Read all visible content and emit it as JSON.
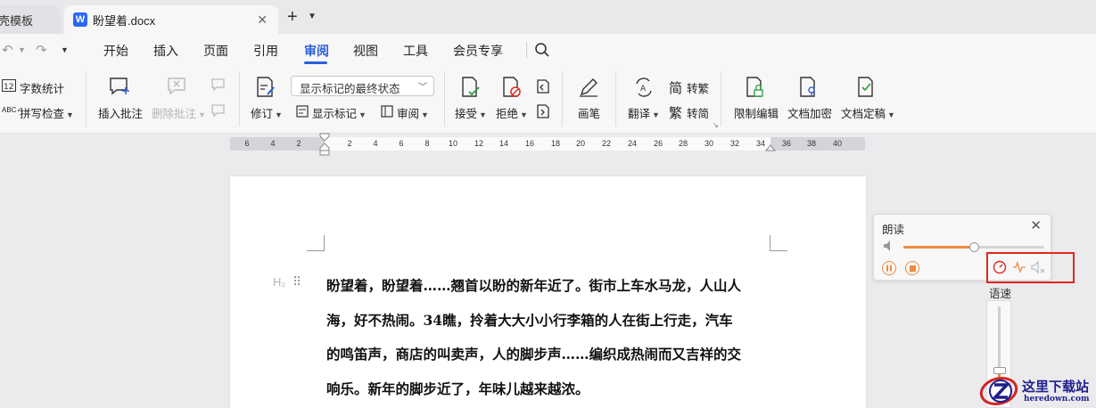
{
  "tabs": {
    "prev_label": "壳模板",
    "active_label": "盼望着.docx",
    "app_letter": "W",
    "close": "✕",
    "add": "+"
  },
  "menu": {
    "items": [
      "开始",
      "插入",
      "页面",
      "引用",
      "审阅",
      "视图",
      "工具",
      "会员专享"
    ],
    "active": "审阅"
  },
  "ribbon": {
    "word_count": "字数统计",
    "spell_check": "拼写检查",
    "insert_comment": "插入批注",
    "delete_comment": "删除批注",
    "track_dropdown": "显示标记的最终状态",
    "revise": "修订",
    "show_markup": "显示标记",
    "review": "审阅",
    "accept": "接受",
    "reject": "拒绝",
    "pen": "画笔",
    "translate": "翻译",
    "to_traditional": "转繁",
    "to_simplified": "转简",
    "restrict_edit": "限制编辑",
    "encrypt": "文档加密",
    "finalize": "文档定稿"
  },
  "ruler": {
    "left_ticks": [
      "6",
      "4",
      "2"
    ],
    "right_ticks": [
      "2",
      "4",
      "6",
      "8",
      "10",
      "12",
      "14",
      "16",
      "18",
      "20",
      "22",
      "24",
      "26",
      "28",
      "30",
      "32",
      "34",
      "36",
      "38",
      "40"
    ]
  },
  "document": {
    "heading_marker": "H₂",
    "paragraph_lines": [
      "盼望着，盼望着……翘首以盼的新年近了。街市上车水马龙，人山人",
      "海，好不热闹。34瞧，拎着大大小小行李箱的人在街上行走，汽车",
      "的鸣笛声，商店的叫卖声，人的脚步声……编织成热闹而又吉祥的交",
      "响乐。新年的脚步近了，年味儿越来越浓。"
    ]
  },
  "read_aloud": {
    "title": "朗读",
    "close": "✕",
    "volume_level": 0.5,
    "speed_label": "语速",
    "speed_level": 0.35
  },
  "watermark": {
    "text": "这里下载站",
    "url": "heredown.com"
  },
  "colors": {
    "accent_blue": "#2b5fd9",
    "accent_orange": "#f08b3e",
    "highlight_red": "#e3261f"
  }
}
